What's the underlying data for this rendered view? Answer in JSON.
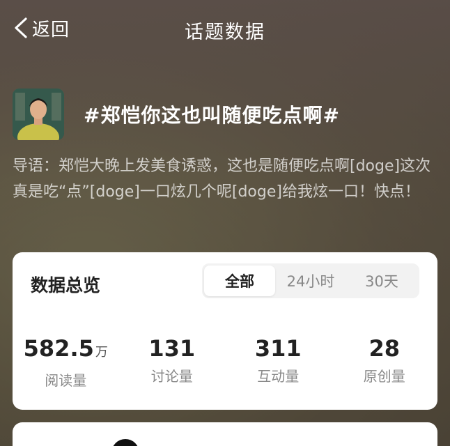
{
  "nav": {
    "back_label": "返回",
    "title": "话题数据"
  },
  "topic": {
    "title": "#郑恺你这也叫随便吃点啊#",
    "intro": "导语：郑恺大晚上发美食诱惑，这也是随便吃点啊[doge]这次真是吃“点”[doge]一口炫几个呢[doge]给我炫一口！快点！"
  },
  "overview": {
    "title": "数据总览",
    "tabs": [
      {
        "label": "全部",
        "active": true
      },
      {
        "label": "24小时",
        "active": false
      },
      {
        "label": "30天",
        "active": false
      }
    ],
    "stats": [
      {
        "value": "582.5",
        "unit": "万",
        "label": "阅读量"
      },
      {
        "value": "131",
        "unit": "",
        "label": "讨论量"
      },
      {
        "value": "311",
        "unit": "",
        "label": "互动量"
      },
      {
        "value": "28",
        "unit": "",
        "label": "原创量"
      }
    ]
  },
  "icons": {
    "back": "chevron-left-icon",
    "avatar": "avatar"
  }
}
